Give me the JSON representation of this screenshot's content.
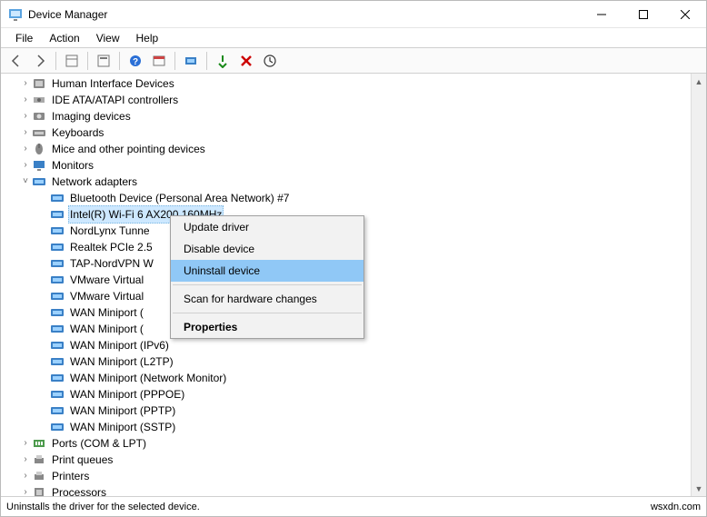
{
  "window": {
    "title": "Device Manager"
  },
  "menubar": [
    "File",
    "Action",
    "View",
    "Help"
  ],
  "tree": {
    "categories": [
      {
        "id": "hid",
        "label": "Human Interface Devices",
        "expanded": false,
        "icon": "hid"
      },
      {
        "id": "ide",
        "label": "IDE ATA/ATAPI controllers",
        "expanded": false,
        "icon": "ide"
      },
      {
        "id": "img",
        "label": "Imaging devices",
        "expanded": false,
        "icon": "img"
      },
      {
        "id": "kbd",
        "label": "Keyboards",
        "expanded": false,
        "icon": "kbd"
      },
      {
        "id": "mouse",
        "label": "Mice and other pointing devices",
        "expanded": false,
        "icon": "mouse"
      },
      {
        "id": "mon",
        "label": "Monitors",
        "expanded": false,
        "icon": "mon"
      },
      {
        "id": "net",
        "label": "Network adapters",
        "expanded": true,
        "icon": "net",
        "children": [
          {
            "label": "Bluetooth Device (Personal Area Network) #7"
          },
          {
            "label": "Intel(R) Wi-Fi 6 AX200 160MHz",
            "selected": true
          },
          {
            "label": "NordLynx Tunne"
          },
          {
            "label": "Realtek PCIe 2.5"
          },
          {
            "label": "TAP-NordVPN W"
          },
          {
            "label": "VMware Virtual "
          },
          {
            "label": "VMware Virtual "
          },
          {
            "label": "WAN Miniport ("
          },
          {
            "label": "WAN Miniport ("
          },
          {
            "label": "WAN Miniport (IPv6)"
          },
          {
            "label": "WAN Miniport (L2TP)"
          },
          {
            "label": "WAN Miniport (Network Monitor)"
          },
          {
            "label": "WAN Miniport (PPPOE)"
          },
          {
            "label": "WAN Miniport (PPTP)"
          },
          {
            "label": "WAN Miniport (SSTP)"
          }
        ]
      },
      {
        "id": "ports",
        "label": "Ports (COM & LPT)",
        "expanded": false,
        "icon": "port"
      },
      {
        "id": "pq",
        "label": "Print queues",
        "expanded": false,
        "icon": "print"
      },
      {
        "id": "pr",
        "label": "Printers",
        "expanded": false,
        "icon": "print"
      },
      {
        "id": "cpu",
        "label": "Processors",
        "expanded": false,
        "icon": "cpu"
      }
    ]
  },
  "context_menu": {
    "items": [
      {
        "label": "Update driver"
      },
      {
        "label": "Disable device"
      },
      {
        "label": "Uninstall device",
        "highlight": true
      },
      {
        "sep": true
      },
      {
        "label": "Scan for hardware changes"
      },
      {
        "sep": true
      },
      {
        "label": "Properties",
        "bold": true
      }
    ]
  },
  "statusbar": {
    "text": "Uninstalls the driver for the selected device.",
    "right": "wsxdn.com"
  }
}
